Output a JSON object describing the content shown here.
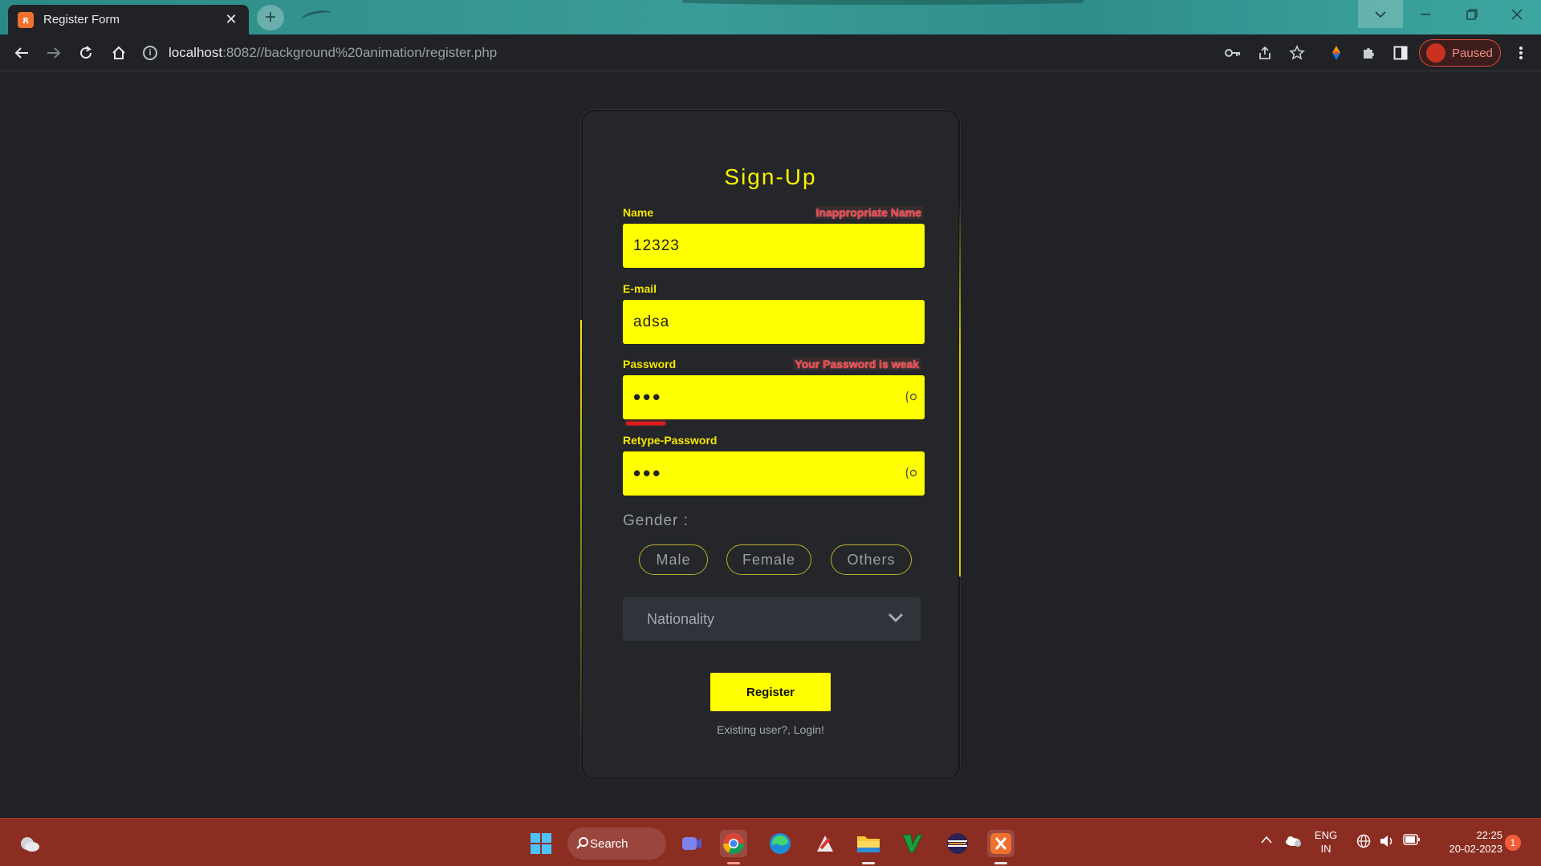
{
  "browser": {
    "tab_title": "Register Form",
    "tab_close": "✕",
    "new_tab": "+",
    "url_host": "localhost",
    "url_rest": ":8082//background%20animation/register.php",
    "profile_status": "Paused",
    "window_controls": [
      "chevron-down-icon",
      "minimize-icon",
      "restore-icon",
      "close-icon"
    ]
  },
  "form": {
    "title": "Sign-Up",
    "name": {
      "label": "Name",
      "value": "12323",
      "error": "Inappropriate Name"
    },
    "email": {
      "label": "E-mail",
      "value": "adsa"
    },
    "password": {
      "label": "Password",
      "value": "•••",
      "error": "Your Password is weak",
      "strength": 0.13,
      "strength_color": "#e01a1a"
    },
    "retype_password": {
      "label": "Retype-Password",
      "value": "•••"
    },
    "gender": {
      "label": "Gender :",
      "options": [
        "Male",
        "Female",
        "Others"
      ]
    },
    "nationality": {
      "placeholder": "Nationality"
    },
    "register_label": "Register",
    "login_text": "Existing user?, Login!"
  },
  "colors": {
    "accent": "#ffff00",
    "error": "#ff3d44",
    "page_bg": "#202226",
    "taskbar": "#8c2d22"
  },
  "taskbar": {
    "search_label": "Search",
    "apps": [
      "windows-start-icon",
      "teams-icon",
      "chrome-icon",
      "edge-icon",
      "app-icon",
      "file-explorer-icon",
      "vim-icon",
      "eclipse-icon",
      "xampp-icon"
    ],
    "lang_top": "ENG",
    "lang_bottom": "IN",
    "time": "22:25",
    "date": "20-02-2023",
    "notification_count": "1"
  }
}
